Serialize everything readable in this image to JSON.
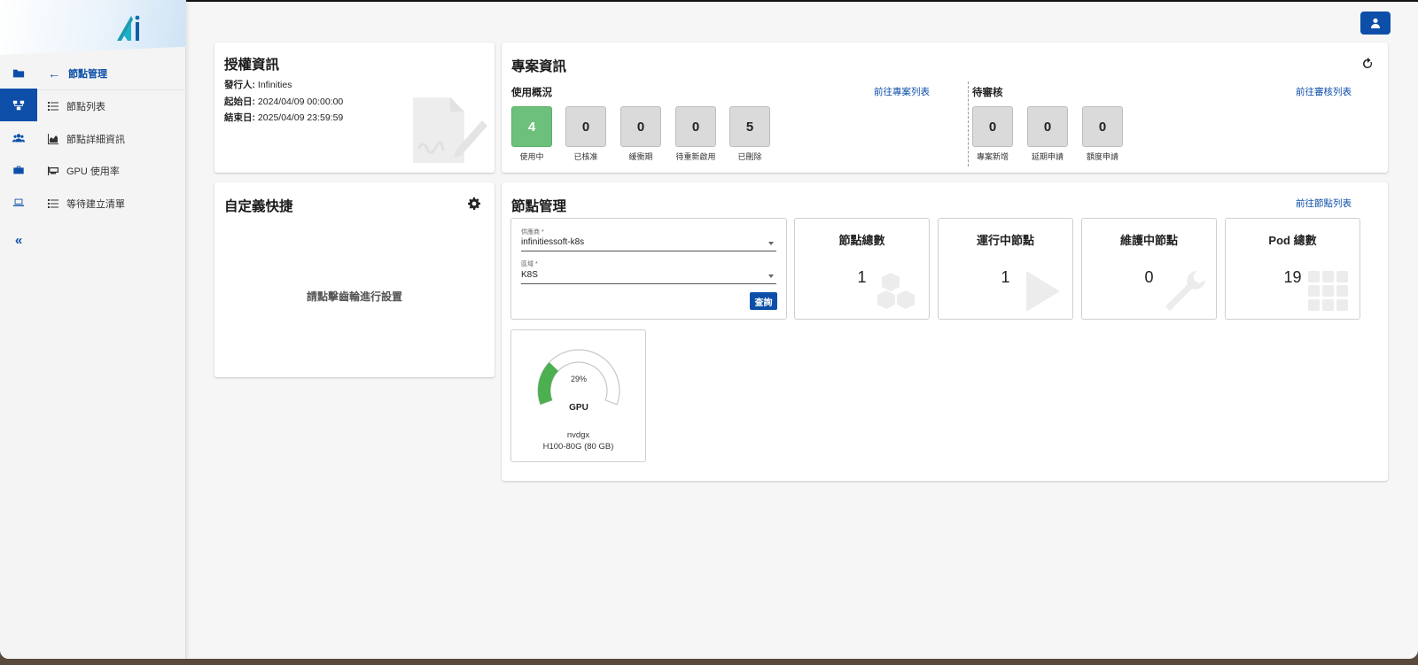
{
  "sidebar": {
    "header": "節點管理",
    "items": [
      {
        "label": "節點列表",
        "icon": "list-icon"
      },
      {
        "label": "節點詳細資訊",
        "icon": "chart-icon"
      },
      {
        "label": "GPU 使用率",
        "icon": "gpu-icon"
      },
      {
        "label": "等待建立清單",
        "icon": "list-icon"
      }
    ],
    "collapse": "«"
  },
  "license": {
    "title": "授權資訊",
    "issuer_label": "發行人:",
    "issuer": "Infinities",
    "start_label": "起始日:",
    "start": "2024/04/09 00:00:00",
    "end_label": "結束日:",
    "end": "2025/04/09 23:59:59"
  },
  "project": {
    "title": "專案資訊",
    "usage_title": "使用概況",
    "usage_link": "前往專案列表",
    "usage_stats": [
      {
        "value": "4",
        "label": "使用中"
      },
      {
        "value": "0",
        "label": "已核准"
      },
      {
        "value": "0",
        "label": "緩衝期"
      },
      {
        "value": "0",
        "label": "待重新啟用"
      },
      {
        "value": "5",
        "label": "已刪除"
      }
    ],
    "pending_title": "待審核",
    "pending_link": "前往審核列表",
    "pending_stats": [
      {
        "value": "0",
        "label": "專案新增"
      },
      {
        "value": "0",
        "label": "延期申請"
      },
      {
        "value": "0",
        "label": "額度申請"
      }
    ]
  },
  "shortcuts": {
    "title": "自定義快捷",
    "message": "請點擊齒輪進行設置"
  },
  "nodes": {
    "title": "節點管理",
    "link": "前往節點列表",
    "provider_label": "供應商 *",
    "provider_value": "infinitiessoft-k8s",
    "region_label": "區域 *",
    "region_value": "K8S",
    "query_button": "查詢",
    "stats": [
      {
        "title": "節點總數",
        "value": "1",
        "icon": "cubes-icon"
      },
      {
        "title": "運行中節點",
        "value": "1",
        "icon": "play-icon"
      },
      {
        "title": "維護中節點",
        "value": "0",
        "icon": "wrench-icon"
      },
      {
        "title": "Pod 總數",
        "value": "19",
        "icon": "grid-icon"
      }
    ],
    "gpu": {
      "percent_label": "29%",
      "percent": 29,
      "label": "GPU",
      "host": "nvdgx",
      "model": "H100-80G (80 GB)"
    }
  },
  "colors": {
    "accent": "#0d4fa8",
    "active_green": "#6cc07b",
    "gauge_green": "#4caf50"
  }
}
